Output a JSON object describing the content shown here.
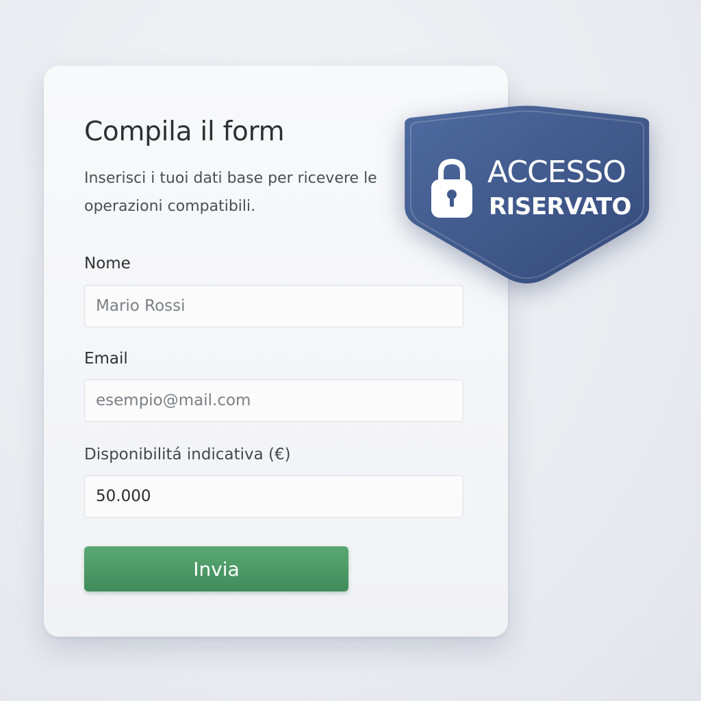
{
  "form": {
    "title": "Compila il form",
    "subtitle": "Inserisci i tuoi dati base per ricevere le operazioni compatibili.",
    "fields": [
      {
        "label": "Nome",
        "placeholder": "Mario Rossi",
        "value": ""
      },
      {
        "label": "Email",
        "placeholder": "esempio@mail.com",
        "value": ""
      },
      {
        "label": "Disponibilitá indicativa (€)",
        "placeholder": "",
        "value": "50.000"
      }
    ],
    "submit_label": "Invia"
  },
  "badge": {
    "line1": "ACCESSO",
    "line2": "RISERVATO",
    "icon": "lock-icon"
  },
  "colors": {
    "badge_blue": "#3f5a8c",
    "button_green": "#4d9a66",
    "background": "#eceef2",
    "card": "#f5f6f8"
  }
}
